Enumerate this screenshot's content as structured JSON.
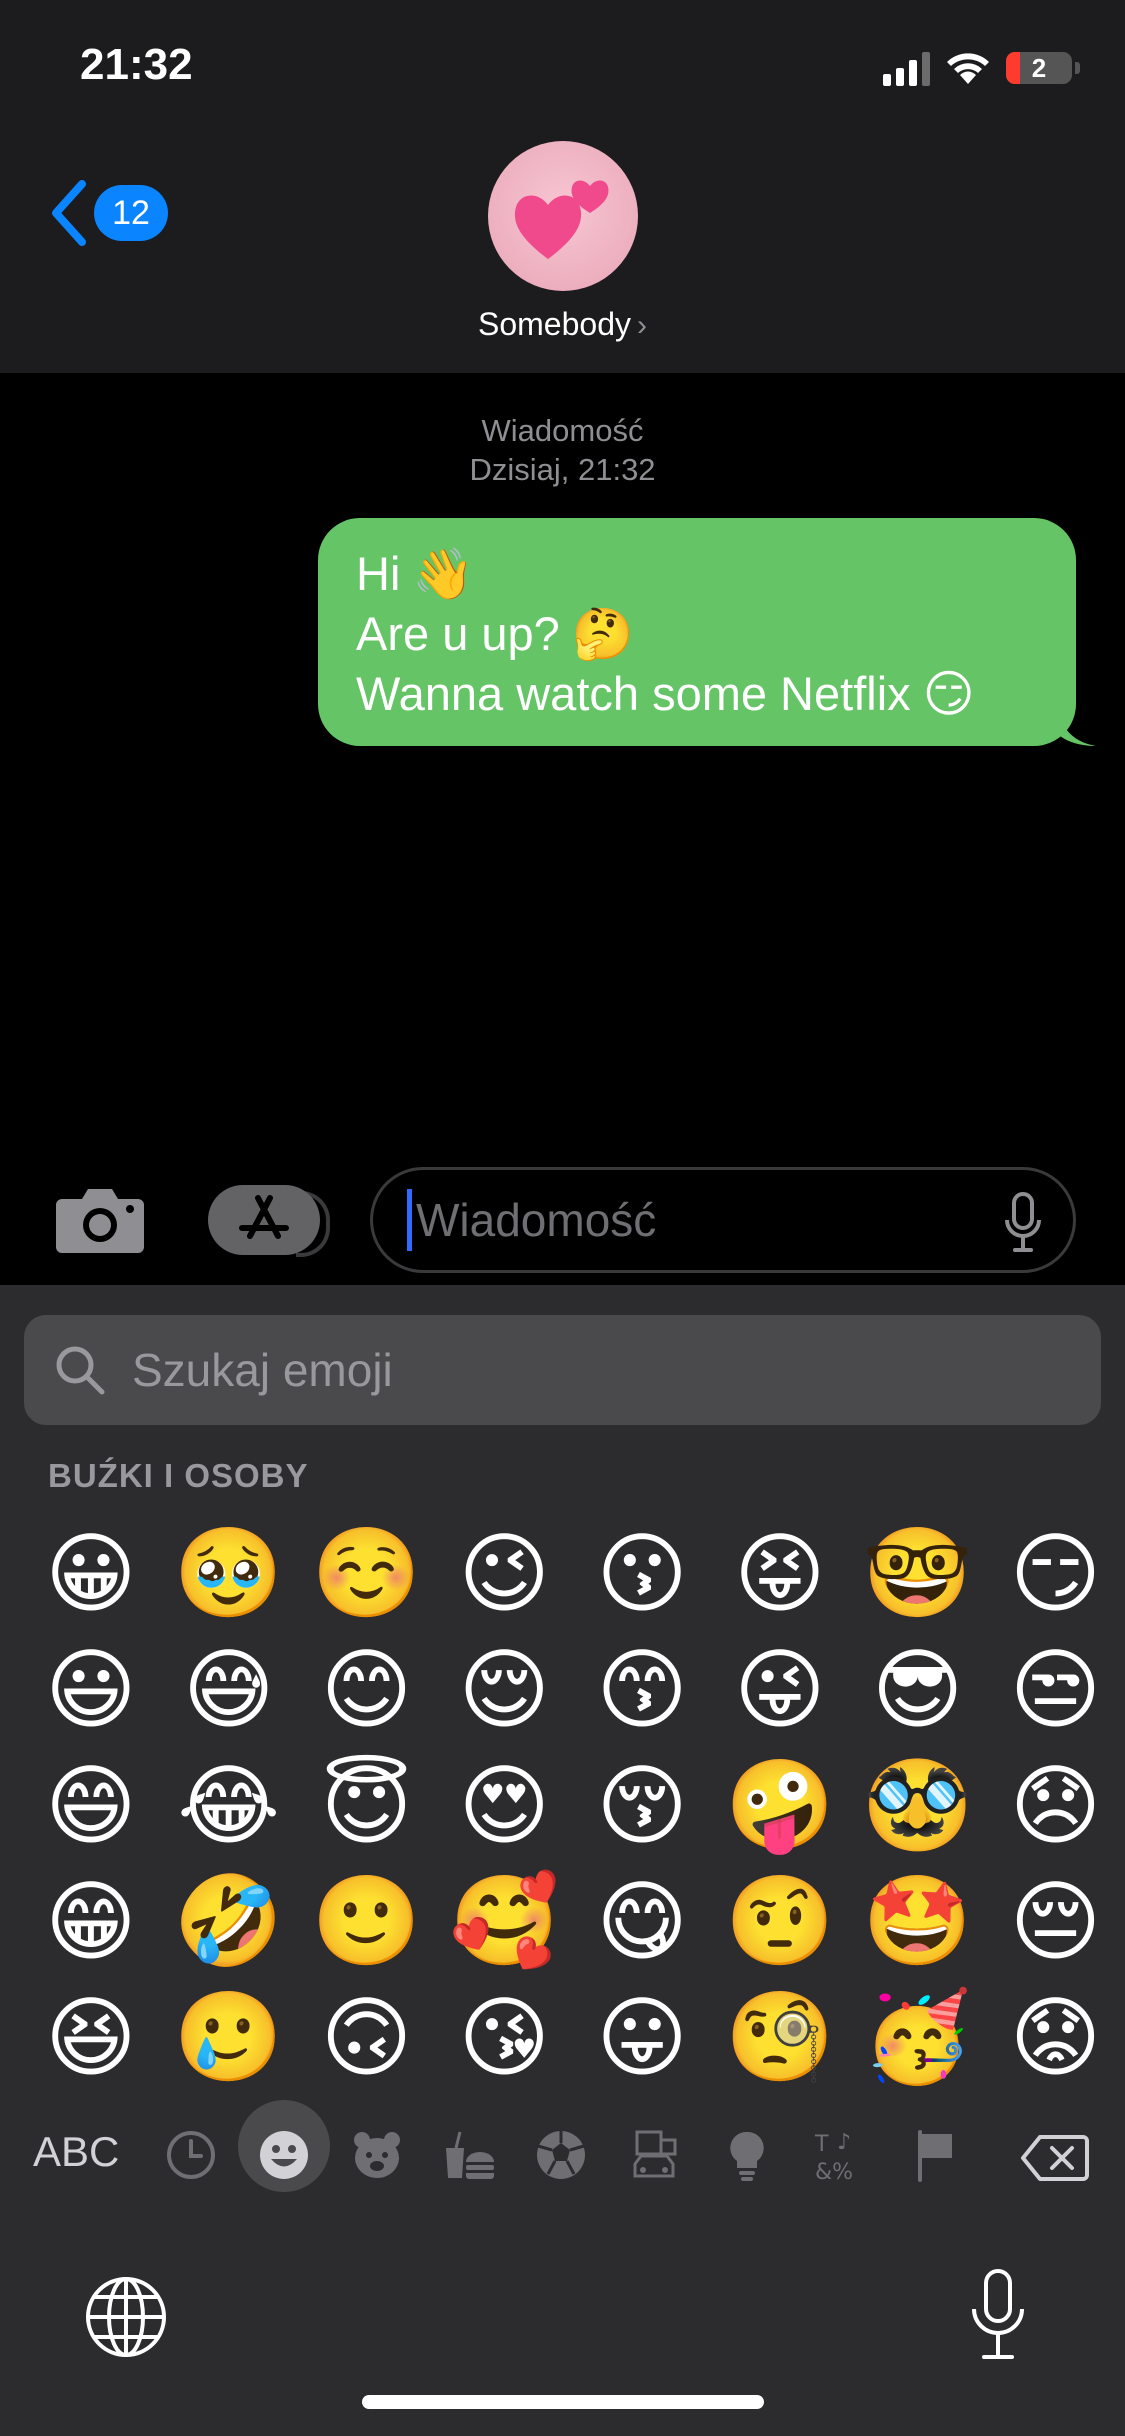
{
  "status_bar": {
    "time": "21:32",
    "battery": "2"
  },
  "header": {
    "back_badge": "12",
    "contact_name": "Somebody",
    "chevron": "›"
  },
  "conversation": {
    "meta_type": "Wiadomość",
    "meta_time": "Dzisiaj, 21:32",
    "bubble_lines": [
      {
        "text": "Hi",
        "emoji": "👋"
      },
      {
        "text": "Are u up?",
        "emoji": "🤔"
      },
      {
        "text": "Wanna watch some Netflix",
        "emoji": "😏"
      }
    ]
  },
  "input_bar": {
    "placeholder": "Wiadomość"
  },
  "keyboard": {
    "search_placeholder": "Szukaj emoji",
    "section_title": "BUŹKI I OSOBY",
    "emojis": [
      "😀",
      "🥹",
      "☺️",
      "😉",
      "😗",
      "😝",
      "🤓",
      "😏",
      "😃",
      "😅",
      "😊",
      "😌",
      "😙",
      "😜",
      "😎",
      "😒",
      "😄",
      "😂",
      "😇",
      "😍",
      "😚",
      "🤪",
      "🥸",
      "😞",
      "😁",
      "🤣",
      "🙂",
      "🥰",
      "😋",
      "🤨",
      "🤩",
      "😔",
      "😆",
      "🥲",
      "🙃",
      "😘",
      "😛",
      "🧐",
      "🥳",
      "😟"
    ],
    "abc_label": "ABC",
    "categories": [
      "recent-icon",
      "smileys-icon",
      "animals-icon",
      "food-icon",
      "activity-icon",
      "travel-icon",
      "objects-icon",
      "symbols-icon",
      "flags-icon"
    ]
  },
  "colors": {
    "bubble": "#65c466",
    "accent": "#0a84ff",
    "keyboard_bg": "#2c2c2e",
    "header_bg": "#1c1c1e"
  }
}
